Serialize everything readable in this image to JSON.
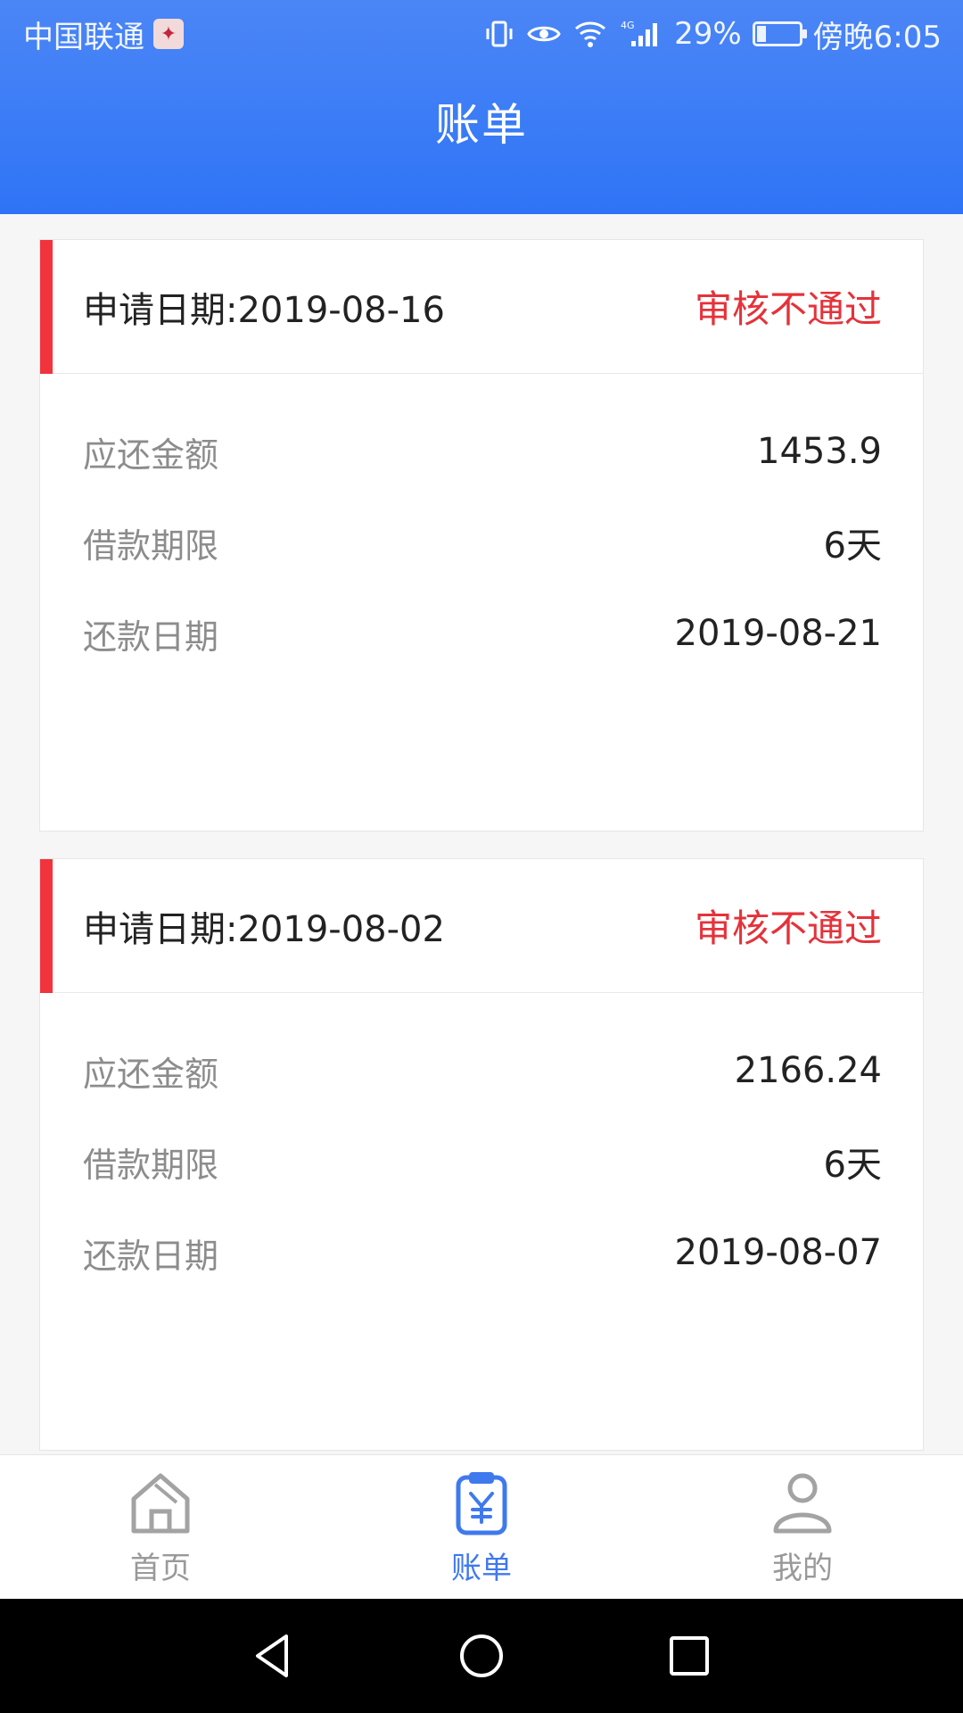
{
  "status_bar": {
    "carrier": "中国联通",
    "network": "4G",
    "battery_text": "29%",
    "battery_level": 0.29,
    "time": "傍晚6:05"
  },
  "header": {
    "title": "账单"
  },
  "bills": [
    {
      "apply_date": "申请日期:2019-08-16",
      "status": "审核不通过",
      "rows": [
        {
          "label": "应还金额",
          "value": "1453.9"
        },
        {
          "label": "借款期限",
          "value": "6天"
        },
        {
          "label": "还款日期",
          "value": "2019-08-21"
        }
      ]
    },
    {
      "apply_date": "申请日期:2019-08-02",
      "status": "审核不通过",
      "rows": [
        {
          "label": "应还金额",
          "value": "2166.24"
        },
        {
          "label": "借款期限",
          "value": "6天"
        },
        {
          "label": "还款日期",
          "value": "2019-08-07"
        }
      ]
    }
  ],
  "tabbar": {
    "items": [
      {
        "label": "首页",
        "icon": "home-icon",
        "active": false
      },
      {
        "label": "账单",
        "icon": "bill-icon",
        "active": true
      },
      {
        "label": "我的",
        "icon": "profile-icon",
        "active": false
      }
    ]
  },
  "colors": {
    "header": "#3c7cf6",
    "accent_red": "#f1333d",
    "status_red": "#e5323a",
    "tab_active": "#3f79ee",
    "tab_inactive": "#999999"
  }
}
